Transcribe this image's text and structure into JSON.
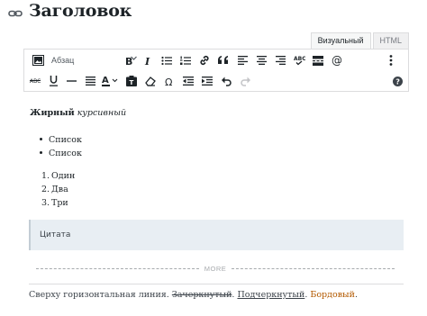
{
  "title": "Заголовок",
  "tabs": [
    "Визуальный",
    "HTML"
  ],
  "toolbar": {
    "format_select": "Абзац",
    "row1_buttons": [
      "bold",
      "italic",
      "bullet-list",
      "numbered-list",
      "link",
      "blockquote",
      "align-left",
      "align-center",
      "align-right",
      "spellcheck",
      "read-more",
      "mention",
      "more-options"
    ],
    "row2_buttons": [
      "strikethrough",
      "underline",
      "horizontal-line",
      "justify",
      "text-color",
      "paste-as-text",
      "clear-formatting",
      "special-character",
      "outdent",
      "indent",
      "undo",
      "redo",
      "help"
    ]
  },
  "content": {
    "bold": "Жирный",
    "italic": "курсивный",
    "bullets": [
      "Список",
      "Список"
    ],
    "numbered": [
      {
        "num": "1.",
        "text": "Один"
      },
      {
        "num": "2.",
        "text": "Два"
      },
      {
        "num": "3.",
        "text": "Три"
      }
    ],
    "quote": "Цитата",
    "more_label": "MORE",
    "final": {
      "plain": "Сверху горизонтальная линия. ",
      "strike": "Зачеркнутый",
      "sep1": ". ",
      "under": "Подчеркнутый",
      "sep2": ". ",
      "colored": "Бордовый",
      "end": "."
    }
  },
  "colors": {
    "quote_bg": "#e8eef3",
    "colored_text": "#b35a00"
  }
}
